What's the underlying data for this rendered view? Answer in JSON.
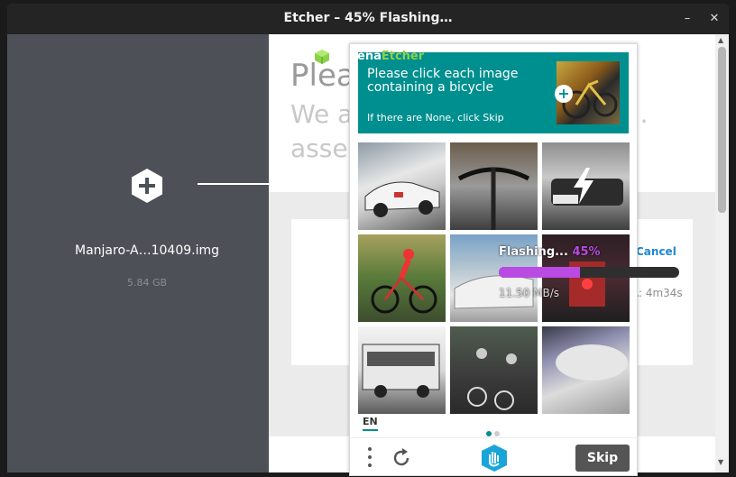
{
  "window": {
    "title": "Etcher – 45% Flashing…",
    "minimize_glyph": "–",
    "close_glyph": "✕"
  },
  "left": {
    "image_name": "Manjaro-A…10409.img",
    "image_size": "5.84 GB"
  },
  "right": {
    "heading1": "Plea",
    "heading2": "We a",
    "heading2b": "er…",
    "heading3": "asse",
    "cancel_label": "Cancel",
    "eta": "ETA: 4m34s"
  },
  "flash": {
    "status": "Flashing...",
    "percent_label": "45%",
    "progress": 0.45,
    "speed": "11.50 MB/s",
    "accent": "#b94be3"
  },
  "captcha": {
    "brand_prefix": "ena",
    "brand_suffix": "Etcher",
    "prompt": "Please click each image containing a bicycle",
    "hint": "If there are None, click Skip",
    "language": "EN",
    "skip_label": "Skip",
    "header_color": "#008f8f",
    "tiles": [
      {
        "label": "race car"
      },
      {
        "label": "bicycle handlebar"
      },
      {
        "label": "car front"
      },
      {
        "label": "cyclist"
      },
      {
        "label": "white car"
      },
      {
        "label": "train"
      },
      {
        "label": "bus"
      },
      {
        "label": "cyclists group"
      },
      {
        "label": "car hood"
      }
    ]
  },
  "icons": {
    "add": "plus-hex-icon",
    "bolt": "lightning-icon",
    "menu": "vertical-dots-icon",
    "refresh": "refresh-icon",
    "accessibility": "hand-icon",
    "cube": "cube-icon"
  }
}
